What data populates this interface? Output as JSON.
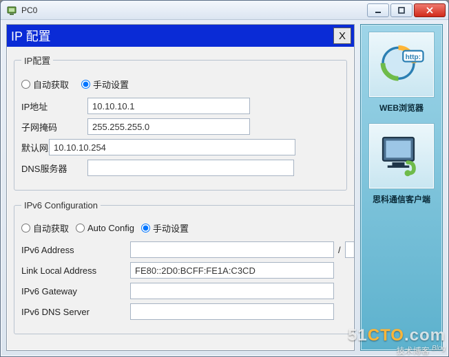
{
  "window": {
    "title": "PC0",
    "min_icon": "minimize-icon",
    "max_icon": "maximize-icon",
    "close_icon": "close-icon"
  },
  "dialog": {
    "title": "IP 配置",
    "close_label": "X"
  },
  "ipv4": {
    "legend": "IP配置",
    "radio_auto": "自动获取",
    "radio_manual": "手动设置",
    "mode": "manual",
    "ip_label": "IP地址",
    "ip_value": "10.10.10.1",
    "subnet_label": "子网掩码",
    "subnet_value": "255.255.255.0",
    "gateway_label": "默认网关",
    "gateway_value": "10.10.10.254",
    "dns_label": "DNS服务器",
    "dns_value": ""
  },
  "ipv6": {
    "legend": "IPv6 Configuration",
    "radio_auto": "自动获取",
    "radio_autoconfig": "Auto Config",
    "radio_manual": "手动设置",
    "mode": "manual",
    "addr_label": "IPv6 Address",
    "addr_value": "",
    "prefix_value": "",
    "lladdr_label": "Link Local Address",
    "lladdr_value": "FE80::2D0:BCFF:FE1A:C3CD",
    "gateway_label": "IPv6 Gateway",
    "gateway_value": "",
    "dns_label": "IPv6 DNS Server",
    "dns_value": ""
  },
  "launchers": {
    "web": "WEB浏览器",
    "cisco": "思科通信客户端"
  },
  "watermark": {
    "brand_pre": "51",
    "brand_mid": "CTO",
    "brand_suf": ".com",
    "sub": "技术博客",
    "blog": "Blog"
  }
}
